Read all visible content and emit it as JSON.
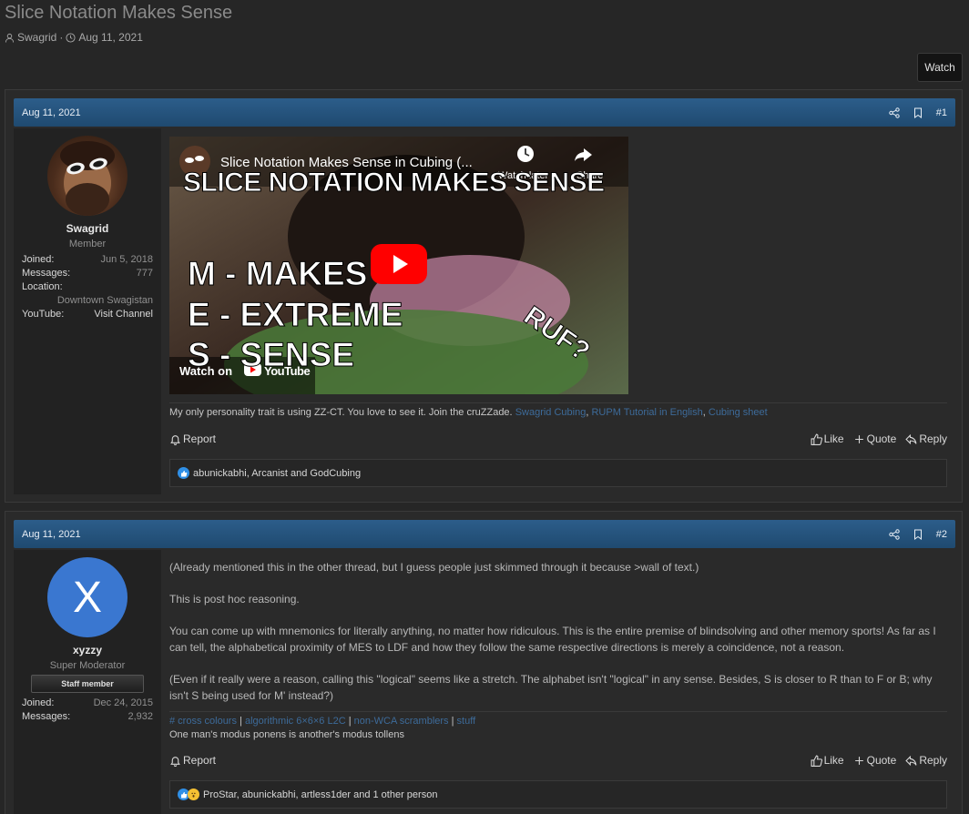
{
  "thread": {
    "title": "Slice Notation Makes Sense",
    "author": "Swagrid",
    "date": "Aug 11, 2021",
    "watch_label": "Watch"
  },
  "posts": [
    {
      "date": "Aug 11, 2021",
      "number": "#1",
      "user": {
        "name": "Swagrid",
        "title": "Member",
        "stats": [
          {
            "k": "Joined:",
            "v": "Jun 5, 2018"
          },
          {
            "k": "Messages:",
            "v": "777"
          },
          {
            "k": "Location:",
            "v": ""
          }
        ],
        "location": "Downtown Swagistan",
        "youtube_label": "YouTube:",
        "youtube_value": "Visit Channel"
      },
      "video": {
        "title": "Slice Notation Makes Sense in Cubing (...",
        "watch_later": "Watch later",
        "share": "Share",
        "big_text": "SLICE NOTATION MAKES SENSE",
        "line1": "M - MAKES",
        "line2": "E - EXTREME",
        "line3": "S - SENSE",
        "ruf": "RUF?",
        "watch_on": "Watch on",
        "youtube": "YouTube"
      },
      "signature": {
        "text": "My only personality trait is using ZZ-CT. You love to see it. Join the cruZZade.",
        "link1": "Swagrid Cubing",
        "sep1": ", ",
        "link2": "RUPM Tutorial in English",
        "sep2": ", ",
        "link3": "Cubing sheet"
      },
      "report": "Report",
      "like": "Like",
      "quote": "Quote",
      "reply": "Reply",
      "reactions": "abunickabhi, Arcanist and GodCubing"
    },
    {
      "date": "Aug 11, 2021",
      "number": "#2",
      "user": {
        "avatar_letter": "X",
        "name": "xyzzy",
        "title": "Super Moderator",
        "badge": "Staff member",
        "stats": [
          {
            "k": "Joined:",
            "v": "Dec 24, 2015"
          },
          {
            "k": "Messages:",
            "v": "2,932"
          }
        ]
      },
      "paragraphs": [
        "(Already mentioned this in the other thread, but I guess people just skimmed through it because >wall of text.)",
        "This is post hoc reasoning.",
        "You can come up with mnemonics for literally anything, no matter how ridiculous. This is the entire premise of blindsolving and other memory sports! As far as I can tell, the alphabetical proximity of MES to LDF and how they follow the same respective directions is merely a coincidence, not a reason.",
        "(Even if it really were a reason, calling this \"logical\" seems like a stretch. The alphabet isn't \"logical\" in any sense. Besides, S is closer to R than to F or B; why isn't S being used for M' instead?)"
      ],
      "signature": {
        "link1": "# cross colours",
        "sep1": " | ",
        "link2": "algorithmic 6×6×6 L2C",
        "sep2": " | ",
        "link3": "non-WCA scramblers",
        "sep3": " | ",
        "link4": "stuff",
        "line2": "One man's modus ponens is another's modus tollens"
      },
      "report": "Report",
      "like": "Like",
      "quote": "Quote",
      "reply": "Reply",
      "reactions": "ProStar, abunickabhi, artless1der and 1 other person"
    }
  ],
  "colors": {
    "header_blue": "#2c5d8a",
    "link": "#3d6b9a",
    "avatar_blue": "#3a77d0"
  }
}
